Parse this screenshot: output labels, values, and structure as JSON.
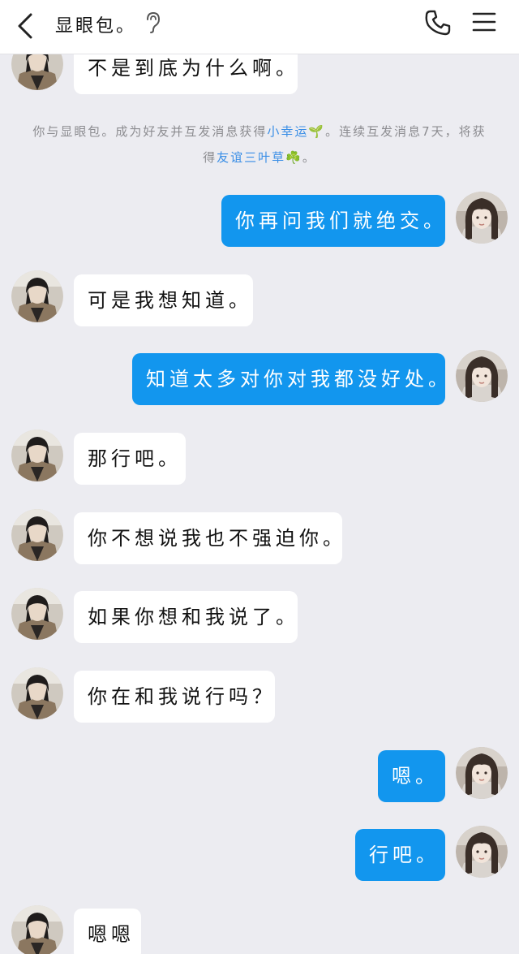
{
  "header": {
    "contact_name": "显眼包。",
    "icons": {
      "back": "chevron-left-icon",
      "ear": "ear-icon",
      "phone": "phone-icon",
      "menu": "hamburger-menu-icon"
    }
  },
  "system_notice": {
    "part1": "你与显眼包。成为好友并互发消息获得",
    "link1": "小幸运",
    "emoji1": "🌱",
    "part2": "。连续互发消息7天，将获得",
    "link2": "友谊三叶草",
    "emoji2": "☘️",
    "part3": "。"
  },
  "messages": [
    {
      "side": "in",
      "text": "不是到底为什么啊。"
    },
    {
      "side": "out",
      "text": "你再问我们就绝交。"
    },
    {
      "side": "in",
      "text": "可是我想知道。"
    },
    {
      "side": "out",
      "text": "知道太多对你对我都没好处。"
    },
    {
      "side": "in",
      "text": "那行吧。"
    },
    {
      "side": "in",
      "text": "你不想说我也不强迫你。"
    },
    {
      "side": "in",
      "text": "如果你想和我说了。"
    },
    {
      "side": "in",
      "text": "你在和我说行吗？"
    },
    {
      "side": "out",
      "text": "嗯。"
    },
    {
      "side": "out",
      "text": "行吧。"
    },
    {
      "side": "in",
      "text": "嗯嗯"
    }
  ],
  "colors": {
    "outgoing_bubble": "#1296ee",
    "incoming_bubble": "#ffffff",
    "background": "#ececf1",
    "link": "#3a8ee6"
  }
}
